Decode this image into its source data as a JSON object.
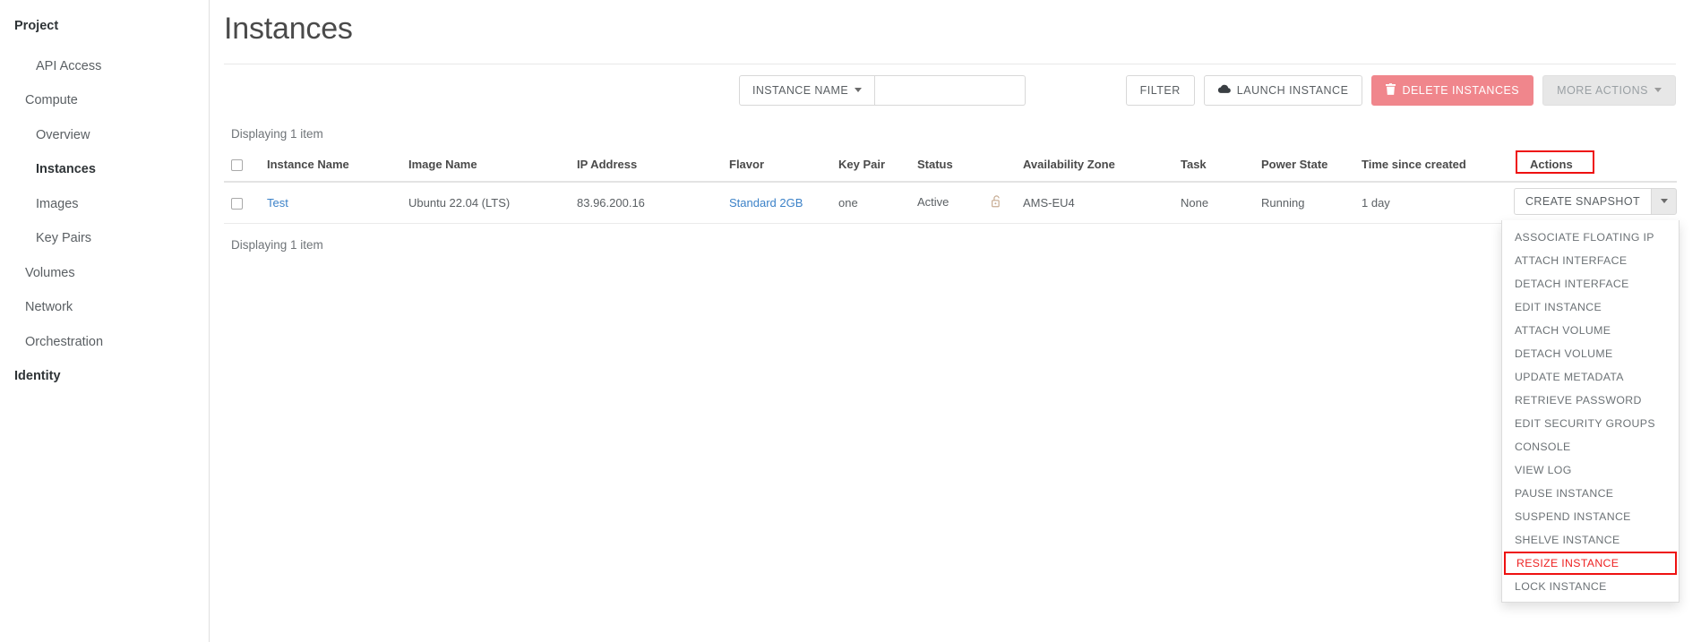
{
  "sidebar": {
    "sections": [
      {
        "label": "Project",
        "level": "root"
      },
      {
        "label": "API Access",
        "level": "sub"
      },
      {
        "label": "Compute",
        "level": "group"
      },
      {
        "label": "Overview",
        "level": "sub"
      },
      {
        "label": "Instances",
        "level": "sub",
        "active": true
      },
      {
        "label": "Images",
        "level": "sub"
      },
      {
        "label": "Key Pairs",
        "level": "sub"
      },
      {
        "label": "Volumes",
        "level": "group"
      },
      {
        "label": "Network",
        "level": "group"
      },
      {
        "label": "Orchestration",
        "level": "group"
      },
      {
        "label": "Identity",
        "level": "root"
      }
    ]
  },
  "header": {
    "title": "Instances"
  },
  "toolbar": {
    "filter_dropdown_label": "INSTANCE NAME",
    "search_value": "",
    "search_placeholder": "",
    "filter_button": "FILTER",
    "launch_button": "LAUNCH INSTANCE",
    "launch_icon": "cloud-icon",
    "delete_button": "DELETE INSTANCES",
    "delete_icon": "trash-icon",
    "more_actions_button": "MORE ACTIONS",
    "more_actions_disabled": true,
    "danger_color": "#f0868c",
    "disabled_color": "#e7e7e7"
  },
  "table": {
    "count_top": "Displaying 1 item",
    "count_bottom": "Displaying 1 item",
    "columns": [
      "Instance Name",
      "Image Name",
      "IP Address",
      "Flavor",
      "Key Pair",
      "Status",
      "Availability Zone",
      "Task",
      "Power State",
      "Time since created",
      "Actions"
    ],
    "rows": [
      {
        "instance_name": "Test",
        "image_name": "Ubuntu 22.04 (LTS)",
        "ip_address": "83.96.200.16",
        "flavor": "Standard 2GB",
        "key_pair": "one",
        "status": "Active",
        "status_icon": "unlock-icon",
        "availability_zone": "AMS-EU4",
        "task": "None",
        "power_state": "Running",
        "time_since_created": "1 day",
        "action_primary": "CREATE SNAPSHOT"
      }
    ]
  },
  "actions_menu": {
    "items": [
      "ASSOCIATE FLOATING IP",
      "ATTACH INTERFACE",
      "DETACH INTERFACE",
      "EDIT INSTANCE",
      "ATTACH VOLUME",
      "DETACH VOLUME",
      "UPDATE METADATA",
      "RETRIEVE PASSWORD",
      "EDIT SECURITY GROUPS",
      "CONSOLE",
      "VIEW LOG",
      "PAUSE INSTANCE",
      "SUSPEND INSTANCE",
      "SHELVE INSTANCE",
      "RESIZE INSTANCE",
      "LOCK INSTANCE"
    ],
    "highlighted_item": "RESIZE INSTANCE",
    "highlight_color": "#ee1111"
  },
  "annotations": {
    "actions_header_highlight_color": "#ee1111"
  }
}
